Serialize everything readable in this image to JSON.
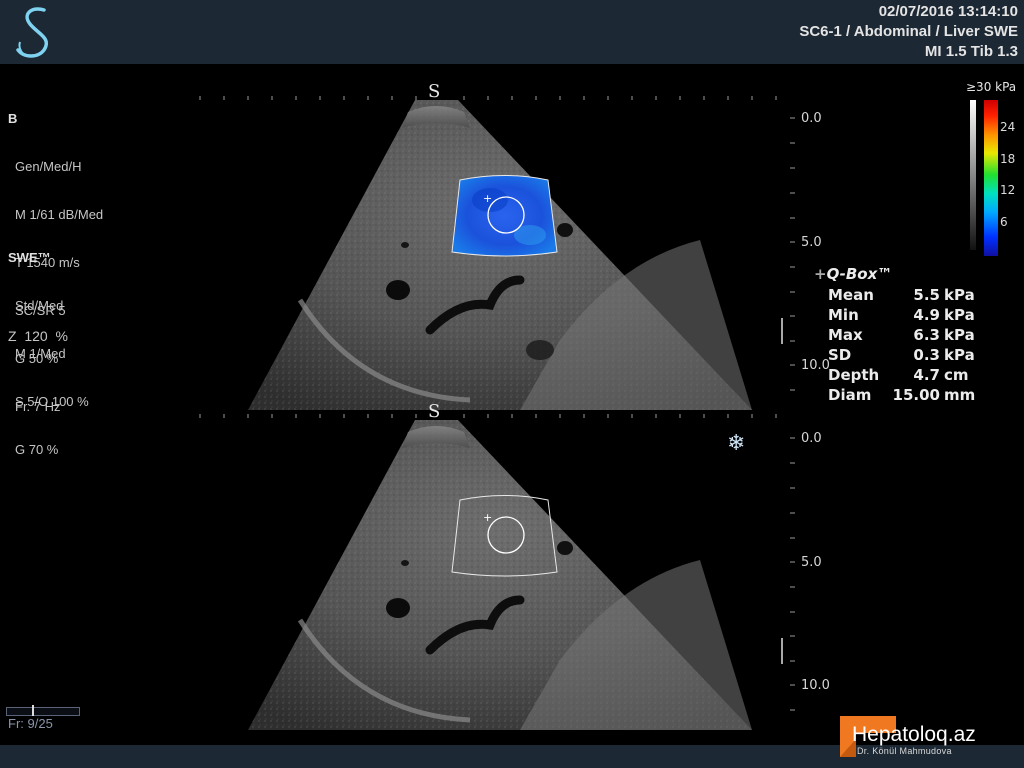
{
  "header": {
    "datetime": "02/07/2016 13:14:10",
    "probe_preset": "SC6-1 / Abdominal / Liver SWE",
    "mi_tib": "MI 1.5  Tib  1.3"
  },
  "b_mode": {
    "title": "B",
    "lines": [
      "Gen/Med/H",
      "M 1/61 dB/Med",
      "T 1540 m/s",
      "SC/SR 5",
      "G 50 %",
      "Fr. 7 Hz"
    ]
  },
  "swe_mode": {
    "title": "SWE™",
    "lines": [
      "Std/Med",
      "M 1/Med",
      "S 5/O 100 %",
      "G 70 %"
    ]
  },
  "zoom": "Z  120  %",
  "depth_scale_top": [
    "0.0",
    "5.0",
    "10.0"
  ],
  "depth_scale_bottom": [
    "0.0",
    "5.0",
    "10.0"
  ],
  "colorbar": {
    "title": "≥30 kPa",
    "labels": [
      "24",
      "18",
      "12",
      "6"
    ]
  },
  "qbox": {
    "title": "Q-Box™",
    "rows": [
      {
        "label": "Mean",
        "value": "5.5",
        "unit": "kPa"
      },
      {
        "label": "Min",
        "value": "4.9",
        "unit": "kPa"
      },
      {
        "label": "Max",
        "value": "6.3",
        "unit": "kPa"
      },
      {
        "label": "SD",
        "value": "0.3",
        "unit": "kPa"
      },
      {
        "label": "Depth",
        "value": "4.7",
        "unit": "cm"
      },
      {
        "label": "Diam",
        "value": "15.00",
        "unit": "mm"
      }
    ]
  },
  "frame_counter": "Fr: 9/25",
  "cine_progress": 0.36,
  "watermark": {
    "title": "Hepatoloq.az",
    "subtitle": "Dr. Könül Mahmudova"
  },
  "icons": {
    "logo": "s-logo-icon",
    "freeze": "snowflake-icon",
    "probe_marker": "probe-orientation-icon"
  },
  "colors": {
    "swe_map": "#1a5ce8",
    "header_bg": "#1c2833",
    "watermark_accent": "#f07820"
  }
}
